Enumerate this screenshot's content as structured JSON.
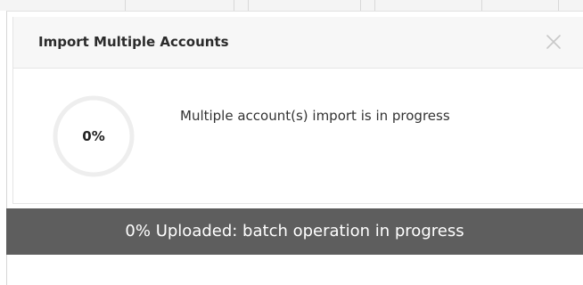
{
  "dialog": {
    "title": "Import Multiple Accounts",
    "close_icon": "close-icon",
    "progress": {
      "label": "0%",
      "value": 0
    },
    "message": "Multiple account(s) import is in progress"
  },
  "banner": {
    "text": "0% Uploaded: batch operation in progress"
  },
  "colors": {
    "banner_bg": "#5e5e5e",
    "ring_track": "#eeeeee",
    "header_bg": "#f7f7f7"
  }
}
